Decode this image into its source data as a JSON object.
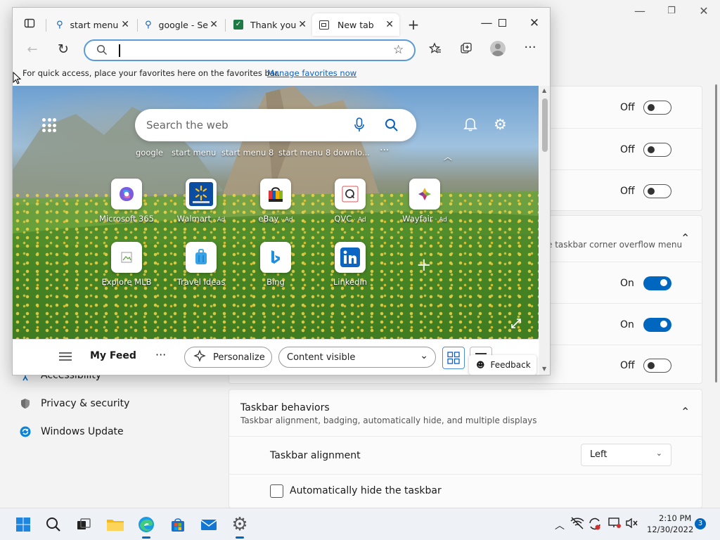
{
  "settings": {
    "toggles": [
      {
        "label": "Off",
        "state": "off"
      },
      {
        "label": "Off",
        "state": "off"
      },
      {
        "label": "Off",
        "state": "off"
      },
      {
        "label": "On",
        "state": "on"
      },
      {
        "label": "On",
        "state": "on"
      },
      {
        "label": "Off",
        "state": "off"
      }
    ],
    "overflow_text": "e taskbar corner overflow menu",
    "behaviors_title": "Taskbar behaviors",
    "behaviors_desc": "Taskbar alignment, badging, automatically hide, and multiple displays",
    "alignment_label": "Taskbar alignment",
    "alignment_value": "Left",
    "autohide_label": "Automatically hide the taskbar",
    "sidebar": [
      {
        "label": "Accessibility"
      },
      {
        "label": "Privacy & security"
      },
      {
        "label": "Windows Update"
      }
    ]
  },
  "edge": {
    "tabs": [
      {
        "label": "start menu"
      },
      {
        "label": "google - Se"
      },
      {
        "label": "Thank you"
      },
      {
        "label": "New tab"
      }
    ],
    "favbar_tip": "For quick access, place your favorites here on the favorites bar.",
    "favbar_link": "Manage favorites now",
    "search_placeholder": "Search the web",
    "quick_links": [
      "google",
      "start menu",
      "start menu 8",
      "start menu 8 downlo..."
    ],
    "tiles": [
      {
        "label": "Microsoft 365",
        "ad": ""
      },
      {
        "label": "Walmart",
        "ad": "Ad"
      },
      {
        "label": "eBay",
        "ad": "Ad"
      },
      {
        "label": "QVC",
        "ad": "Ad"
      },
      {
        "label": "Wayfair",
        "ad": "Ad"
      },
      {
        "label": "Explore MLB",
        "ad": ""
      },
      {
        "label": "Travel Ideas",
        "ad": ""
      },
      {
        "label": "Bing",
        "ad": ""
      },
      {
        "label": "LinkedIn",
        "ad": ""
      }
    ],
    "feed_title": "My Feed",
    "personalize": "Personalize",
    "content_visible": "Content visible",
    "feedback": "Feedback"
  },
  "taskbar": {
    "time": "2:10 PM",
    "date": "12/30/2022",
    "notification_count": "3"
  },
  "colors": {
    "accent": "#0067c0",
    "link": "#0f5fbf"
  }
}
